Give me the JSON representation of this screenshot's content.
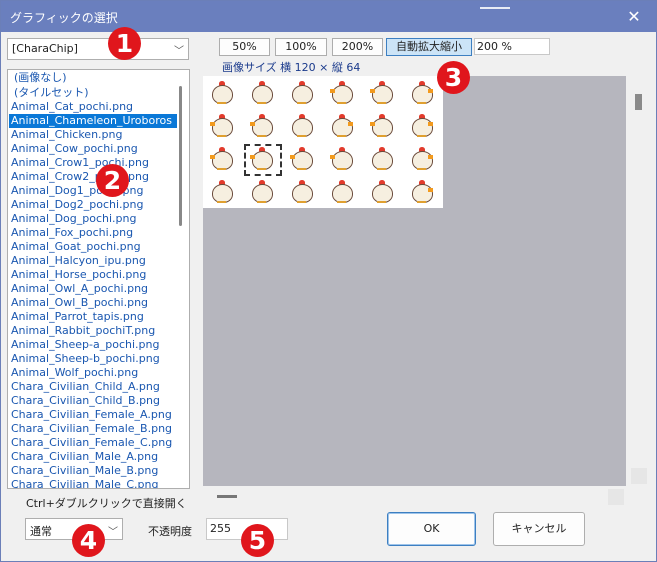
{
  "window": {
    "title": "グラフィックの選択",
    "close_icon": "close-icon"
  },
  "category": {
    "value": "[CharaChip]"
  },
  "file_list": {
    "selected_index": 3,
    "items": [
      "(画像なし)",
      "(タイルセット)",
      "Animal_Cat_pochi.png",
      "Animal_Chameleon_Uroboros",
      "Animal_Chicken.png",
      "Animal_Cow_pochi.png",
      "Animal_Crow1_pochi.png",
      "Animal_Crow2_pochi.png",
      "Animal_Dog1_pochi.png",
      "Animal_Dog2_pochi.png",
      "Animal_Dog_pochi.png",
      "Animal_Fox_pochi.png",
      "Animal_Goat_pochi.png",
      "Animal_Halcyon_ipu.png",
      "Animal_Horse_pochi.png",
      "Animal_Owl_A_pochi.png",
      "Animal_Owl_B_pochi.png",
      "Animal_Parrot_tapis.png",
      "Animal_Rabbit_pochiT.png",
      "Animal_Sheep-a_pochi.png",
      "Animal_Sheep-b_pochi.png",
      "Animal_Wolf_pochi.png",
      "Chara_Civilian_Child_A.png",
      "Chara_Civilian_Child_B.png",
      "Chara_Civilian_Female_A.png",
      "Chara_Civilian_Female_B.png",
      "Chara_Civilian_Female_C.png",
      "Chara_Civilian_Male_A.png",
      "Chara_Civilian_Male_B.png",
      "Chara_Civilian_Male_C.png"
    ]
  },
  "zoom": {
    "buttons": [
      "50%",
      "100%",
      "200%",
      "自動拡大縮小"
    ],
    "active": "自動拡大縮小",
    "value": "200 %"
  },
  "image_size": "画像サイズ  横 120 × 縦 64",
  "hint": "Ctrl+ダブルクリックで直接開く",
  "blend": {
    "value": "通常"
  },
  "opacity": {
    "label": "不透明度",
    "value": "255"
  },
  "buttons": {
    "ok": "OK",
    "cancel": "キャンセル"
  },
  "badges": [
    "1",
    "2",
    "3",
    "4",
    "5"
  ],
  "colors": {
    "titlebar": "#6a7fbe",
    "selection": "#0a78d7",
    "badge": "#e0161c",
    "preview_bg": "#b6b6be"
  }
}
